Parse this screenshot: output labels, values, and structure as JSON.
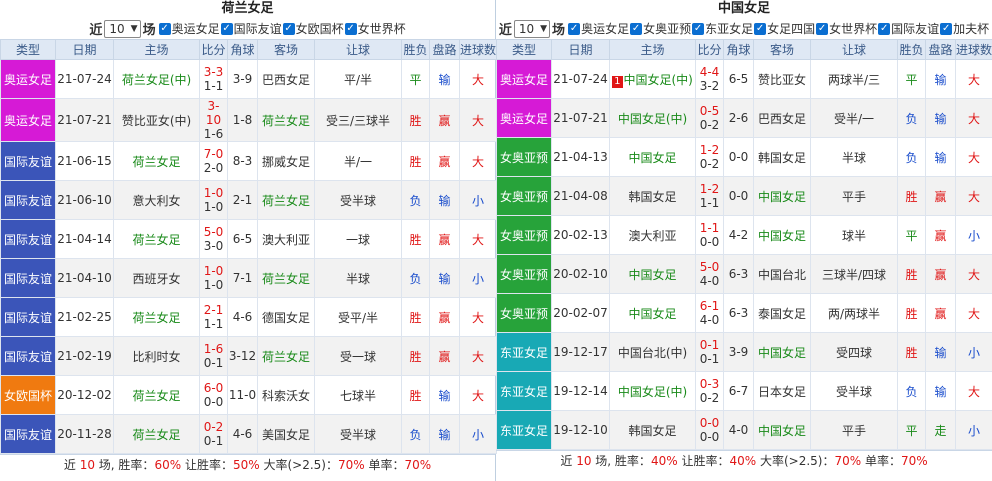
{
  "left": {
    "title": "荷兰女足",
    "filter": {
      "prefix": "近",
      "count": "10",
      "suffix": "场",
      "checks": [
        "奥运女足",
        "国际友谊",
        "女欧国杯",
        "女世界杯"
      ]
    },
    "headers": [
      "类型",
      "日期",
      "主场",
      "比分",
      "角球",
      "客场",
      "让球",
      "胜负",
      "盘路",
      "进球数"
    ],
    "rows": [
      {
        "type": "奥运女足",
        "date": "21-07-24",
        "home": "荷兰女足(中)",
        "ft": "3-3",
        "ht": "1-1",
        "corner": "3-9",
        "away": "巴西女足",
        "hcap": "平/半",
        "wl": "平",
        "pan": "输",
        "goals": "大"
      },
      {
        "type": "奥运女足",
        "date": "21-07-21",
        "home": "赞比亚女(中)",
        "ft": "3-10",
        "ht": "1-6",
        "corner": "1-8",
        "away": "荷兰女足",
        "hcap": "受三/三球半",
        "wl": "胜",
        "pan": "赢",
        "goals": "大"
      },
      {
        "type": "国际友谊",
        "date": "21-06-15",
        "home": "荷兰女足",
        "ft": "7-0",
        "ht": "2-0",
        "corner": "8-3",
        "away": "挪威女足",
        "hcap": "半/一",
        "wl": "胜",
        "pan": "赢",
        "goals": "大"
      },
      {
        "type": "国际友谊",
        "date": "21-06-10",
        "home": "意大利女",
        "ft": "1-0",
        "ht": "1-0",
        "corner": "2-1",
        "away": "荷兰女足",
        "hcap": "受半球",
        "wl": "负",
        "pan": "输",
        "goals": "小"
      },
      {
        "type": "国际友谊",
        "date": "21-04-14",
        "home": "荷兰女足",
        "ft": "5-0",
        "ht": "3-0",
        "corner": "6-5",
        "away": "澳大利亚",
        "hcap": "一球",
        "wl": "胜",
        "pan": "赢",
        "goals": "大"
      },
      {
        "type": "国际友谊",
        "date": "21-04-10",
        "home": "西班牙女",
        "ft": "1-0",
        "ht": "1-0",
        "corner": "7-1",
        "away": "荷兰女足",
        "hcap": "半球",
        "wl": "负",
        "pan": "输",
        "goals": "小"
      },
      {
        "type": "国际友谊",
        "date": "21-02-25",
        "home": "荷兰女足",
        "ft": "2-1",
        "ht": "1-1",
        "corner": "4-6",
        "away": "德国女足",
        "hcap": "受平/半",
        "wl": "胜",
        "pan": "赢",
        "goals": "大"
      },
      {
        "type": "国际友谊",
        "date": "21-02-19",
        "home": "比利时女",
        "ft": "1-6",
        "ht": "0-1",
        "corner": "3-12",
        "away": "荷兰女足",
        "hcap": "受一球",
        "wl": "胜",
        "pan": "赢",
        "goals": "大"
      },
      {
        "type": "女欧国杯",
        "date": "20-12-02",
        "home": "荷兰女足",
        "ft": "6-0",
        "ht": "0-0",
        "corner": "11-0",
        "away": "科索沃女",
        "hcap": "七球半",
        "wl": "胜",
        "pan": "输",
        "goals": "大"
      },
      {
        "type": "国际友谊",
        "date": "20-11-28",
        "home": "荷兰女足",
        "ft": "0-2",
        "ht": "0-1",
        "corner": "4-6",
        "away": "美国女足",
        "hcap": "受半球",
        "wl": "负",
        "pan": "输",
        "goals": "小"
      }
    ],
    "summary": {
      "p1": "近",
      "n": "10",
      "p2": "场, 胜率：",
      "win": "60%",
      "p3": "让胜率：",
      "hwin": "50%",
      "p4": "大率(>2.5)：",
      "big": "70%",
      "p5": "单率：",
      "odd": "70%"
    }
  },
  "right": {
    "title": "中国女足",
    "filter": {
      "prefix": "近",
      "count": "10",
      "suffix": "场",
      "checks": [
        "奥运女足",
        "女奥亚预",
        "东亚女足",
        "女足四国",
        "女世界杯",
        "国际友谊",
        "加夫杯"
      ]
    },
    "headers": [
      "类型",
      "日期",
      "主场",
      "比分",
      "角球",
      "客场",
      "让球",
      "胜负",
      "盘路",
      "进球数"
    ],
    "rows": [
      {
        "type": "奥运女足",
        "date": "21-07-24",
        "badge": "1",
        "home": "中国女足(中)",
        "ft": "4-4",
        "ht": "3-2",
        "corner": "6-5",
        "away": "赞比亚女",
        "hcap": "两球半/三",
        "wl": "平",
        "pan": "输",
        "goals": "大"
      },
      {
        "type": "奥运女足",
        "date": "21-07-21",
        "badge": "",
        "home": "中国女足(中)",
        "ft": "0-5",
        "ht": "0-2",
        "corner": "2-6",
        "away": "巴西女足",
        "hcap": "受半/一",
        "wl": "负",
        "pan": "输",
        "goals": "大"
      },
      {
        "type": "女奥亚预",
        "date": "21-04-13",
        "badge": "",
        "home": "中国女足",
        "ft": "1-2",
        "ht": "0-2",
        "corner": "0-0",
        "away": "韩国女足",
        "hcap": "半球",
        "wl": "负",
        "pan": "输",
        "goals": "大"
      },
      {
        "type": "女奥亚预",
        "date": "21-04-08",
        "badge": "",
        "home": "韩国女足",
        "ft": "1-2",
        "ht": "1-1",
        "corner": "0-0",
        "away": "中国女足",
        "hcap": "平手",
        "wl": "胜",
        "pan": "赢",
        "goals": "大"
      },
      {
        "type": "女奥亚预",
        "date": "20-02-13",
        "badge": "",
        "home": "澳大利亚",
        "ft": "1-1",
        "ht": "0-0",
        "corner": "4-2",
        "away": "中国女足",
        "hcap": "球半",
        "wl": "平",
        "pan": "赢",
        "goals": "小"
      },
      {
        "type": "女奥亚预",
        "date": "20-02-10",
        "badge": "",
        "home": "中国女足",
        "ft": "5-0",
        "ht": "4-0",
        "corner": "6-3",
        "away": "中国台北",
        "hcap": "三球半/四球",
        "wl": "胜",
        "pan": "赢",
        "goals": "大"
      },
      {
        "type": "女奥亚预",
        "date": "20-02-07",
        "badge": "",
        "home": "中国女足",
        "ft": "6-1",
        "ht": "4-0",
        "corner": "6-3",
        "away": "泰国女足",
        "hcap": "两/两球半",
        "wl": "胜",
        "pan": "赢",
        "goals": "大"
      },
      {
        "type": "东亚女足",
        "date": "19-12-17",
        "badge": "",
        "home": "中国台北(中)",
        "ft": "0-1",
        "ht": "0-1",
        "corner": "3-9",
        "away": "中国女足",
        "hcap": "受四球",
        "wl": "胜",
        "pan": "输",
        "goals": "小"
      },
      {
        "type": "东亚女足",
        "date": "19-12-14",
        "badge": "",
        "home": "中国女足(中)",
        "ft": "0-3",
        "ht": "0-2",
        "corner": "6-7",
        "away": "日本女足",
        "hcap": "受半球",
        "wl": "负",
        "pan": "输",
        "goals": "大"
      },
      {
        "type": "东亚女足",
        "date": "19-12-10",
        "badge": "",
        "home": "韩国女足",
        "ft": "0-0",
        "ht": "0-0",
        "corner": "4-0",
        "away": "中国女足",
        "hcap": "平手",
        "wl": "平",
        "pan": "走",
        "goals": "小"
      }
    ],
    "summary": {
      "p1": "近",
      "n": "10",
      "p2": "场, 胜率：",
      "win": "40%",
      "p3": "让胜率：",
      "hwin": "40%",
      "p4": "大率(>2.5)：",
      "big": "70%",
      "p5": "单率：",
      "odd": "70%"
    }
  },
  "colors": {
    "奥运女足": "#d61ad6",
    "国际友谊": "#3b55b9",
    "女欧国杯": "#f07a10",
    "女奥亚预": "#27a33a",
    "东亚女足": "#18a9b5",
    "win": "#e01616",
    "lose": "#1a4dcc",
    "draw": "#198a19"
  },
  "icons": {
    "check": "check-icon",
    "dropdown": "chevron-down-icon"
  }
}
